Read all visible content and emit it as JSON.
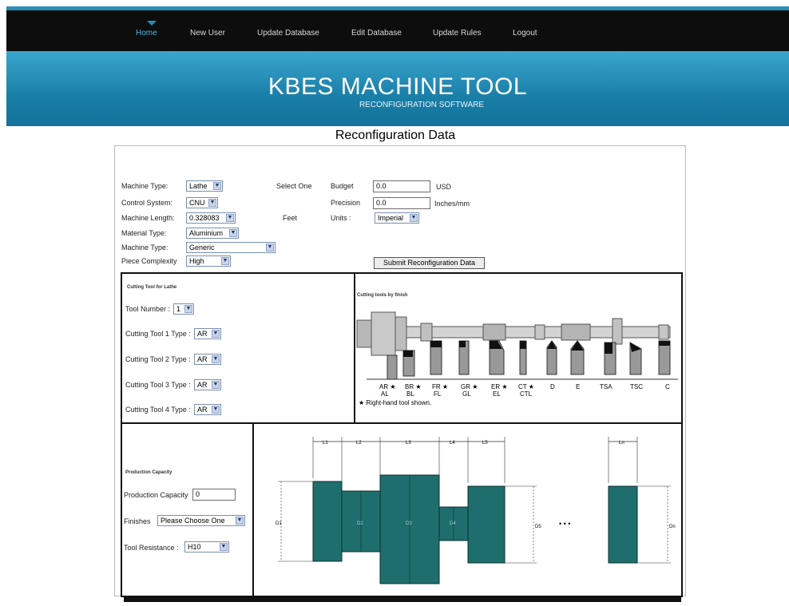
{
  "nav": {
    "items": [
      {
        "label": "Home",
        "active": true
      },
      {
        "label": "New User"
      },
      {
        "label": "Update Database"
      },
      {
        "label": "Edit Database"
      },
      {
        "label": "Update Rules"
      },
      {
        "label": "Logout"
      }
    ]
  },
  "banner": {
    "title": "KBES MACHINE TOOL",
    "subtitle": "RECONFIGURATION SOFTWARE"
  },
  "page": {
    "heading": "Reconfiguration Data"
  },
  "form": {
    "machine_type_label": "Machine Type:",
    "machine_type_value": "Lathe",
    "control_system_label": "Control System:",
    "control_system_value": "CNU",
    "machine_length_label": "Machine Length:",
    "machine_length_value": "0.328083",
    "material_type_label": "Material Type:",
    "material_type_value": "Aluminium",
    "machine_type2_label": "Machine Type:",
    "machine_type2_value": "Generic",
    "piece_complexity_label": "Piece Complexity",
    "piece_complexity_value": "High",
    "select_one_label": "Select One",
    "feet_label": "Feet",
    "budget_label": "Budget",
    "budget_value": "0.0",
    "budget_unit": "USD",
    "precision_label": "Precision",
    "precision_value": "0.0",
    "precision_unit": "Inches/mm",
    "units_label": "Units :",
    "units_value": "Imperial",
    "submit_label": "Submit Reconfiguration Data"
  },
  "cutting": {
    "title": "Cutting Tool for Lathe",
    "tool_number_label": "Tool Number :",
    "tool_number_value": "1",
    "tool_types": [
      {
        "label": "Cutting Tool 1 Type :",
        "value": "AR"
      },
      {
        "label": "Cutting Tool 2 Type :",
        "value": "AR"
      },
      {
        "label": "Cutting Tool 3 Type :",
        "value": "AR"
      },
      {
        "label": "Cutting Tool 4 Type :",
        "value": "AR"
      }
    ]
  },
  "cutting_diagram": {
    "title": "Cutting tools by finish",
    "labels": [
      {
        "top": "AR ★",
        "bottom": "AL"
      },
      {
        "top": "BR ★",
        "bottom": "BL"
      },
      {
        "top": "FR ★",
        "bottom": "FL"
      },
      {
        "top": "GR ★",
        "bottom": "GL"
      },
      {
        "top": "ER ★",
        "bottom": "EL"
      },
      {
        "top": "CT ★",
        "bottom": "CTL"
      },
      {
        "top": "D",
        "bottom": ""
      },
      {
        "top": "E",
        "bottom": ""
      },
      {
        "top": "TSA",
        "bottom": ""
      },
      {
        "top": "TSC",
        "bottom": ""
      },
      {
        "top": "C",
        "bottom": ""
      }
    ],
    "note": "★ Right-hand tool shown."
  },
  "production": {
    "title": "Production Capacity",
    "capacity_label": "Production Capacity",
    "capacity_value": "0",
    "finishes_label": "Finishes",
    "finishes_value": "Please Choose One",
    "tool_resistance_label": "Tool Resistance :",
    "tool_resistance_value": "H10"
  },
  "shaft_diagram": {
    "length_labels": [
      "L1",
      "L2",
      "L3",
      "L4",
      "L5",
      "Ln"
    ],
    "diameter_labels": [
      "D1",
      "D2",
      "D3",
      "D4",
      "D5",
      "Dn"
    ],
    "ellipsis": "•  •  •",
    "colors": {
      "section": "#1f6e6e",
      "stroke": "#0b2f2f"
    }
  }
}
